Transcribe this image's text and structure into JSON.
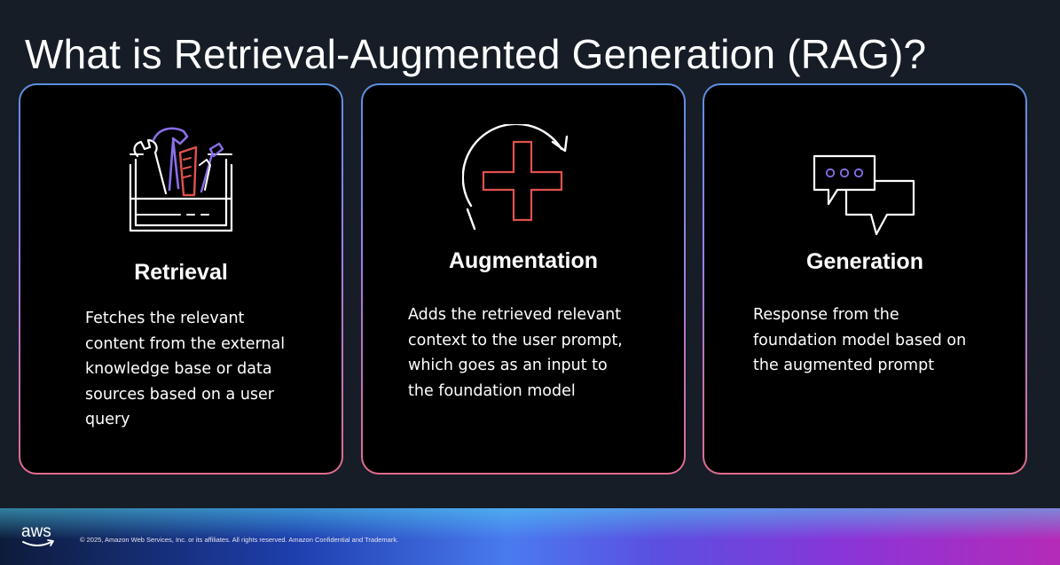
{
  "title": "What is Retrieval-Augmented Generation (RAG)?",
  "cards": [
    {
      "title": "Retrieval",
      "lines": [
        "Fetches the relevant",
        "content from the external",
        "knowledge base or data",
        "sources based on a user",
        "query"
      ],
      "icon": "toolbox-icon"
    },
    {
      "title": "Augmentation",
      "lines": [
        "Adds the retrieved relevant",
        "context to the user prompt,",
        "which goes as an input to",
        "the foundation model"
      ],
      "icon": "plus-cycle-icon"
    },
    {
      "title": "Generation",
      "lines": [
        "Response from the",
        "foundation model based on",
        "the augmented prompt"
      ],
      "icon": "chat-bubbles-icon"
    }
  ],
  "footer": {
    "logo_text": "aws",
    "copyright": "© 2025, Amazon Web Services, Inc. or its affiliates. All rights reserved. Amazon Confidential and Trademark."
  },
  "colors": {
    "background": "#161d26",
    "card_border_top": "#5b8fe0",
    "card_border_bottom": "#e06b8d",
    "icon_red": "#e0524f",
    "icon_purple": "#8b6ee8"
  }
}
